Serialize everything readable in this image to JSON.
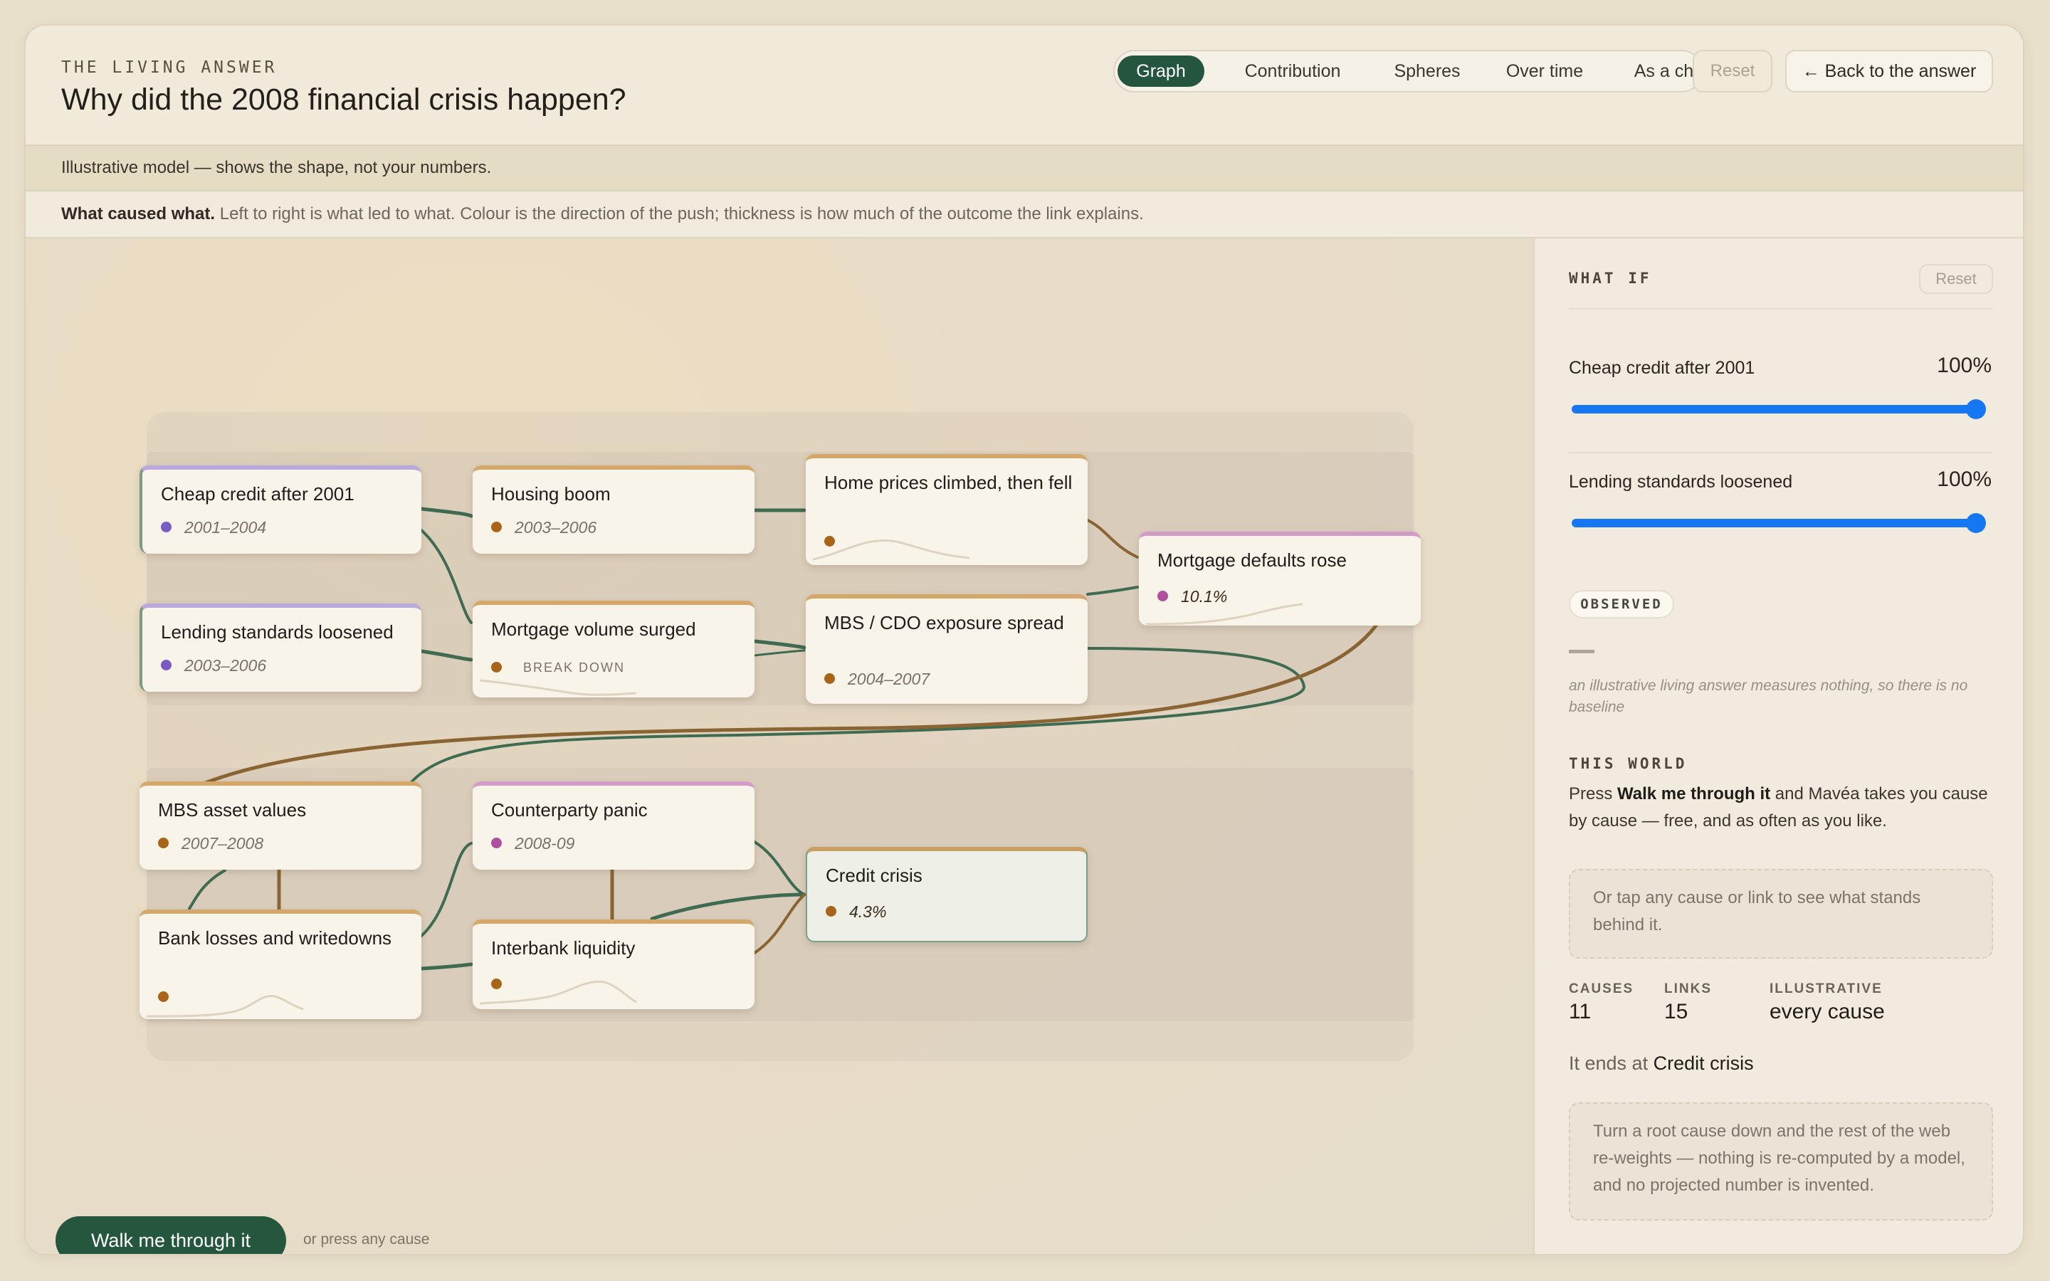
{
  "header": {
    "eyebrow": "THE LIVING ANSWER",
    "title": "Why did the 2008 financial crisis happen?",
    "tabs": [
      {
        "label": "Graph",
        "active": true
      },
      {
        "label": "Contribution",
        "active": false
      },
      {
        "label": "Spheres",
        "active": false
      },
      {
        "label": "Over time",
        "active": false
      },
      {
        "label": "As a chart",
        "active": false
      }
    ],
    "reset_label": "Reset",
    "back_label": "← Back to the answer"
  },
  "notice": "Illustrative model — shows the shape, not your numbers.",
  "legend": {
    "lead": "What caused what.",
    "text": "Left to right is what led to what. Colour is the direction of the push; thickness is how much of the outcome the link explains."
  },
  "colors": {
    "accent": "#24563f",
    "link_green": "#3f6b52",
    "link_brown": "#8a6432",
    "dot_purple": "#7a5bc4",
    "dot_brown": "#a8651a",
    "dot_pink": "#b04f9c",
    "slider": "#1677f2"
  },
  "nodes": [
    {
      "id": "cheap-credit",
      "title": "Cheap credit after 2001",
      "sub": "2001–2004",
      "dot": "purple"
    },
    {
      "id": "housing-boom",
      "title": "Housing boom",
      "sub": "2003–2006",
      "dot": "brown"
    },
    {
      "id": "home-prices",
      "title": "Home prices climbed, then fell",
      "sub": "",
      "dot": "brown"
    },
    {
      "id": "mortgage-defaults",
      "title": "Mortgage defaults rose",
      "sub": "10.1%",
      "dot": "pink"
    },
    {
      "id": "lending-standards",
      "title": "Lending standards loosened",
      "sub": "2003–2006",
      "dot": "purple"
    },
    {
      "id": "mortgage-volume",
      "title": "Mortgage volume surged",
      "sub": "BREAK DOWN",
      "dot": "brown"
    },
    {
      "id": "mbs-cdo",
      "title": "MBS / CDO exposure spread",
      "sub": "2004–2007",
      "dot": "brown"
    },
    {
      "id": "mbs-values",
      "title": "MBS asset values",
      "sub": "2007–2008",
      "dot": "brown"
    },
    {
      "id": "counterparty",
      "title": "Counterparty panic",
      "sub": "2008-09",
      "dot": "pink"
    },
    {
      "id": "credit-crisis",
      "title": "Credit crisis",
      "sub": "4.3%",
      "dot": "brown"
    },
    {
      "id": "bank-losses",
      "title": "Bank losses and writedowns",
      "sub": "",
      "dot": "brown"
    },
    {
      "id": "interbank",
      "title": "Interbank liquidity",
      "sub": "",
      "dot": "brown"
    }
  ],
  "walk": {
    "button_label": "Walk me through it",
    "hint": "or press any cause"
  },
  "panel": {
    "what_if_label": "WHAT IF",
    "reset_label": "Reset",
    "sliders": [
      {
        "label": "Cheap credit after 2001",
        "value": "100%",
        "fraction": 1.0
      },
      {
        "label": "Lending standards loosened",
        "value": "100%",
        "fraction": 1.0
      }
    ],
    "observed_label": "OBSERVED",
    "observed_note": "an illustrative living answer measures nothing, so there is no baseline",
    "this_world_label": "THIS WORLD",
    "this_world_pre": "Press ",
    "this_world_bold": "Walk me through it",
    "this_world_post": " and Mavéa takes you cause by cause — free, and as often as you like.",
    "tap_hint": "Or tap any cause or link to see what stands behind it.",
    "stats": [
      {
        "label": "CAUSES",
        "value": "11"
      },
      {
        "label": "LINKS",
        "value": "15"
      },
      {
        "label": "ILLUSTRATIVE",
        "value": "every cause"
      }
    ],
    "ends_pre": "It ends at",
    "ends_node": "Credit crisis",
    "footer_note": "Turn a root cause down and the rest of the web re-weights — nothing is re-computed by a model, and no projected number is invented."
  }
}
